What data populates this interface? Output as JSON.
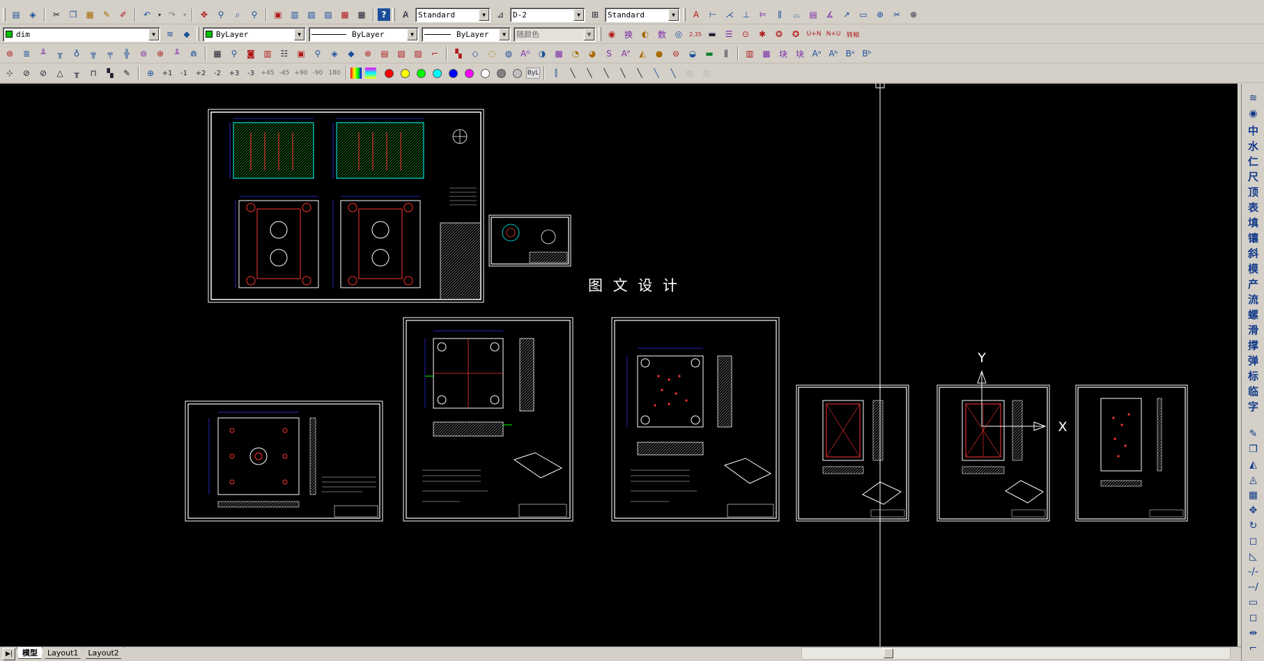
{
  "toolbar_row1": {
    "text_style": "Standard",
    "dim_style": "D-2",
    "table_style": "Standard"
  },
  "toolbar_row2": {
    "layer": "dim",
    "color": "ByLayer",
    "linetype": "ByLayer",
    "lineweight": "ByLayer",
    "plot_style": "随颜色",
    "tool_labels": [
      "U+N",
      "N+U",
      "转相"
    ]
  },
  "toolbar_row4": {
    "angle_labels": [
      "+1",
      "-1",
      "+2",
      "-2",
      "+3",
      "-3",
      "+45",
      "-45",
      "+90",
      "-90",
      "180"
    ],
    "bylayer_label": "ByL",
    "palette": [
      "#ff0000",
      "#ffff00",
      "#00ff00",
      "#00ffff",
      "#0000ff",
      "#ff00ff",
      "#ffffff",
      "#808080",
      "#c0c0c0"
    ]
  },
  "canvas": {
    "background": "#000000",
    "title_text": "图 文 设 计",
    "ucs_y_label": "Y",
    "ucs_x_label": "X"
  },
  "right_toolbar": {
    "chinese_tools": [
      "中",
      "水",
      "仁",
      "尺",
      "顶",
      "表",
      "填",
      "镶",
      "斜",
      "模",
      "产",
      "流",
      "螺",
      "滑",
      "撑",
      "弹",
      "标",
      "临",
      "字"
    ]
  },
  "layout_tabs": [
    {
      "label": "模型",
      "active": true
    },
    {
      "label": "Layout1",
      "active": false
    },
    {
      "label": "Layout2",
      "active": false
    }
  ]
}
